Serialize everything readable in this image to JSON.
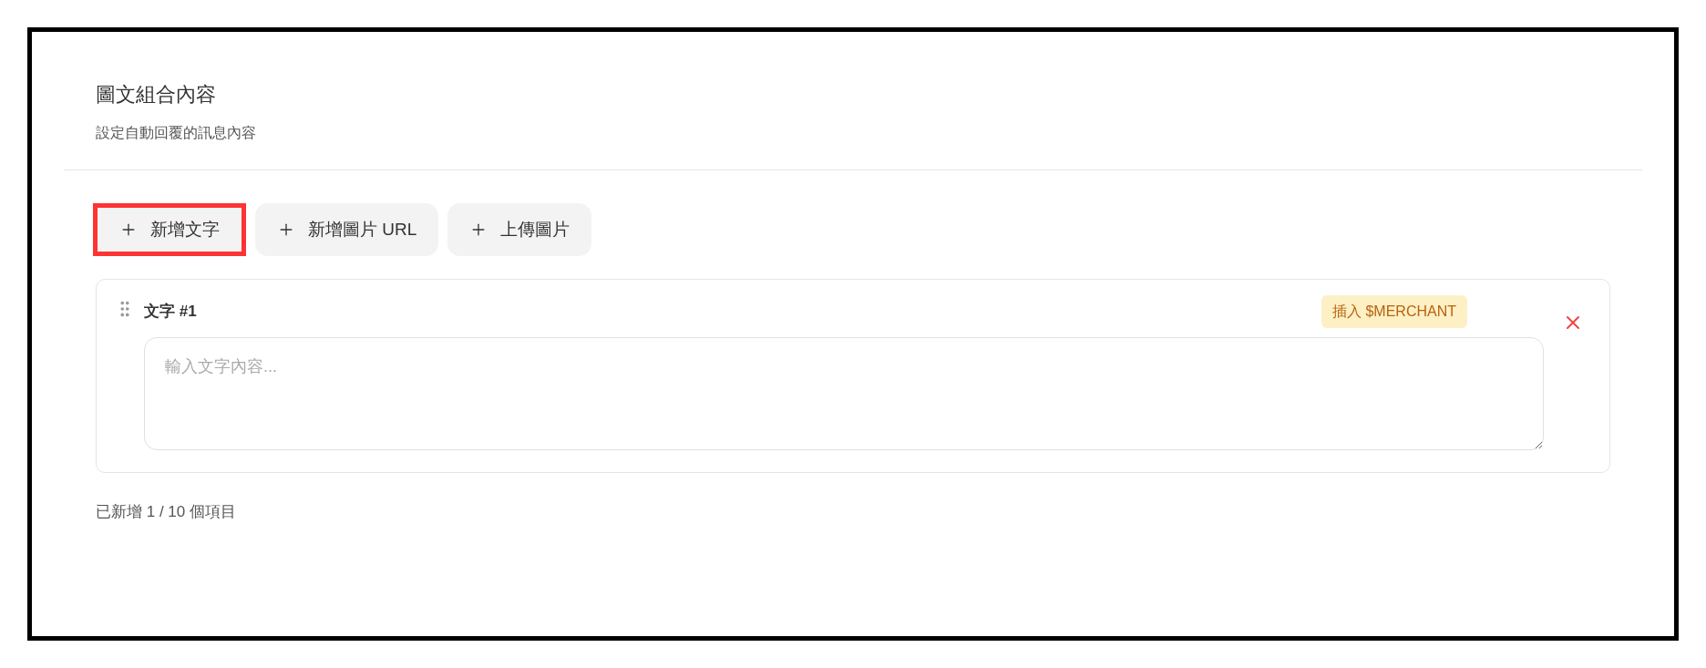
{
  "section": {
    "title": "圖文組合內容",
    "subtitle": "設定自動回覆的訊息內容"
  },
  "add_buttons": [
    {
      "label": "新增文字",
      "highlighted": true
    },
    {
      "label": "新增圖片 URL",
      "highlighted": false
    },
    {
      "label": "上傳圖片",
      "highlighted": false
    }
  ],
  "items": [
    {
      "kind": "text",
      "label": "文字 #1",
      "insert_button": "插入 $MERCHANT",
      "placeholder": "輸入文字內容..."
    }
  ],
  "footer": "已新增 1 / 10 個項目"
}
